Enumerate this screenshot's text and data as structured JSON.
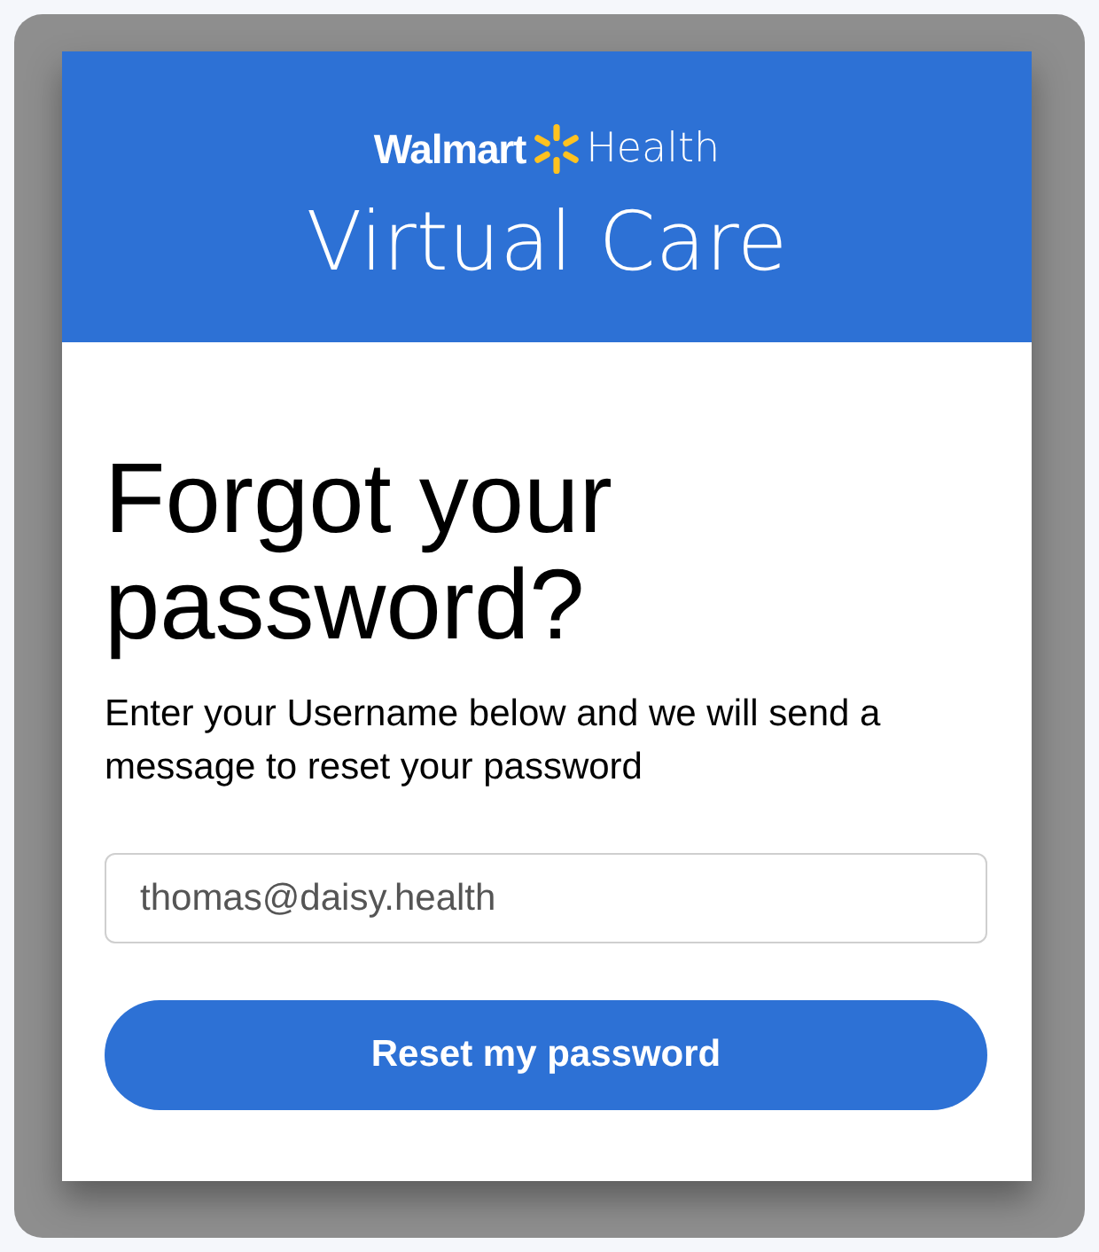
{
  "header": {
    "logo": {
      "brand": "Walmart",
      "product": "Health"
    },
    "title": "Virtual Care"
  },
  "form": {
    "heading": "Forgot your password?",
    "instructions": "Enter your Username below and we will send a message to reset your password",
    "username_field": {
      "value": "thomas@daisy.health"
    },
    "submit_button": "Reset my password"
  }
}
